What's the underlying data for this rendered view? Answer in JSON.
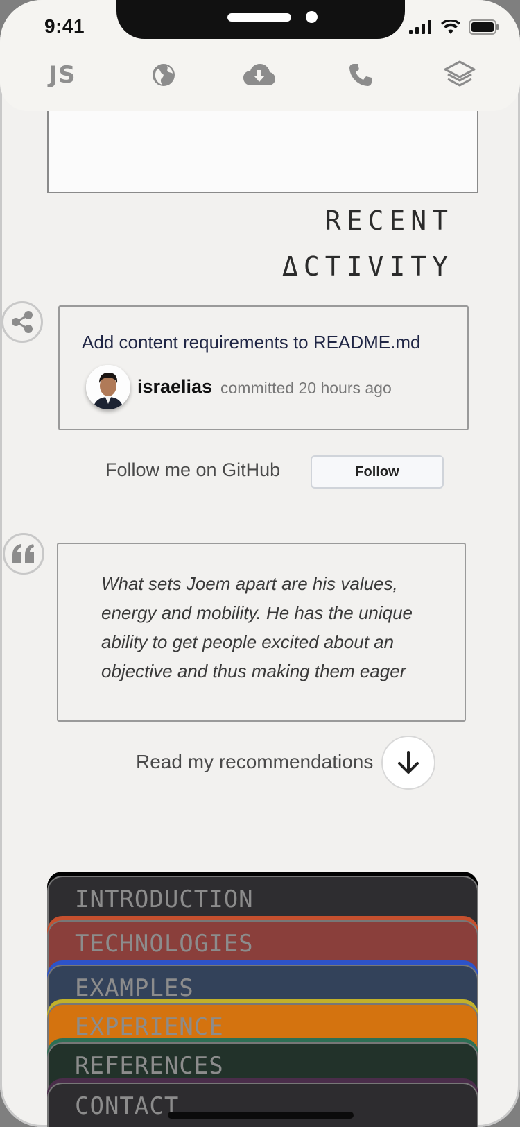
{
  "status_bar": {
    "time": "9:41"
  },
  "nav": {
    "logo": "JS",
    "items": [
      {
        "icon": "globe-icon"
      },
      {
        "icon": "cloud-download-icon"
      },
      {
        "icon": "phone-icon"
      },
      {
        "icon": "layers-icon"
      }
    ]
  },
  "recent_activity": {
    "title_line1": "RECENT",
    "title_line2": "ΔCTIVITY",
    "commit_message": "Add content requirements to README.md",
    "user": "israelias",
    "meta": "committed 20 hours ago",
    "follow_text": "Follow me on GitHub",
    "follow_button": "Follow"
  },
  "recommendation": {
    "quote": "What sets Joem apart are his values, energy and mobility. He has the unique ability to get people excited about an objective and thus making them eager",
    "read_more": "Read my recommendations"
  },
  "tabs": [
    {
      "label": "INTRODUCTION",
      "color": "#2e2d30",
      "edge": "#000000"
    },
    {
      "label": "TECHNOLOGIES",
      "color": "#8a3f3b",
      "edge": "#c6502e"
    },
    {
      "label": "EXAMPLES",
      "color": "#33425a",
      "edge": "#2d53c9"
    },
    {
      "label": "EXPERIENCE",
      "color": "#d4730f",
      "edge": "#c2b12a"
    },
    {
      "label": "REFERENCES",
      "color": "#22322a",
      "edge": "#2e6f55"
    },
    {
      "label": "CONTACT",
      "color": "#2d2c2f",
      "edge": "#4a2d4a"
    }
  ],
  "colors": {
    "background": "#f2f1ef",
    "accent_text": "#1f2544"
  }
}
